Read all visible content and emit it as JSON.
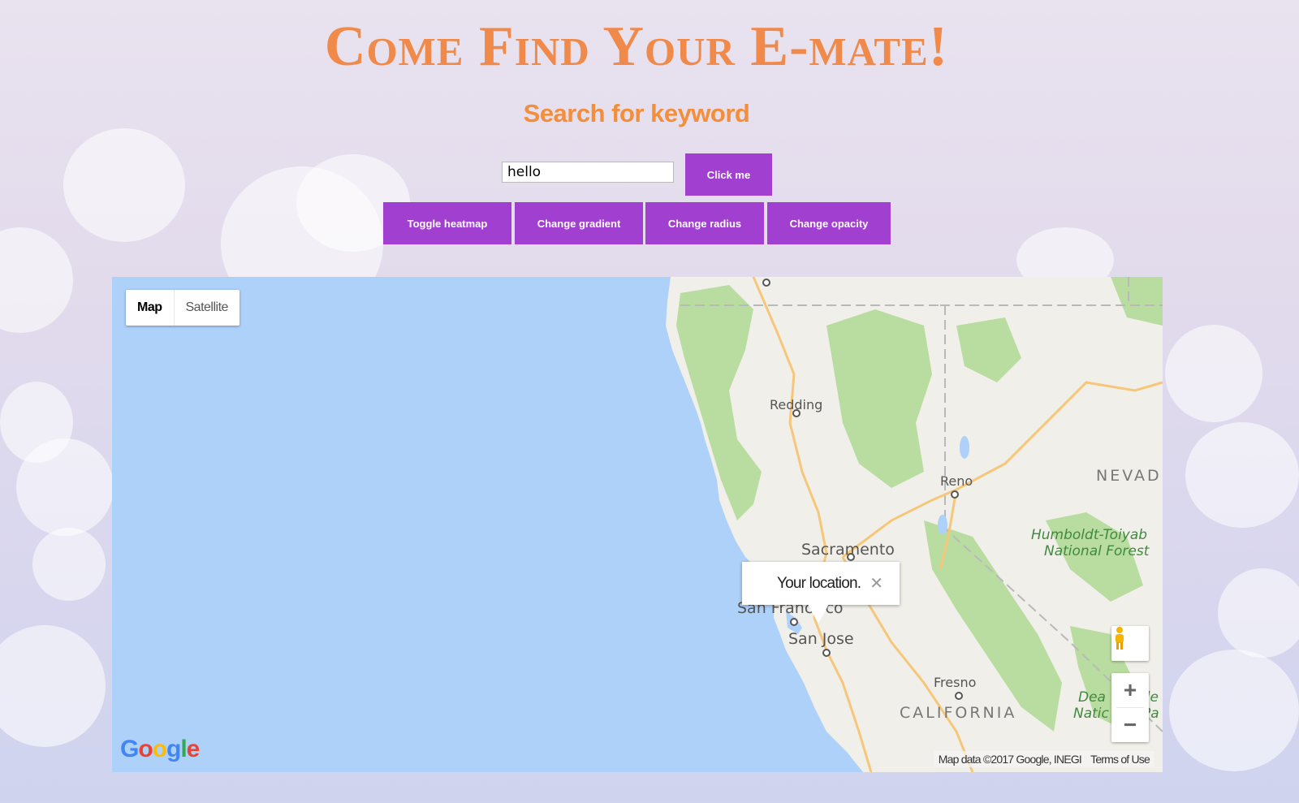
{
  "header": {
    "title": "Come Find Your E-mate!",
    "subtitle": "Search for keyword"
  },
  "search": {
    "value": "hello",
    "submit_label": "Click me"
  },
  "toolbar": {
    "toggle_heatmap": "Toggle heatmap",
    "change_gradient": "Change gradient",
    "change_radius": "Change radius",
    "change_opacity": "Change opacity"
  },
  "map": {
    "type_control": {
      "map_label": "Map",
      "satellite_label": "Satellite",
      "selected": "Map"
    },
    "info_window": {
      "text": "Your location.",
      "close_glyph": "✕"
    },
    "labels": {
      "redding": "Redding",
      "reno": "Reno",
      "nevada": "NEVAD",
      "sacramento": "Sacramento",
      "san_francisco": "San Francisco",
      "san_jose": "San Jose",
      "fresno": "Fresno",
      "california": "CALIFORNIA",
      "humboldt": "Humboldt-Toiyab",
      "national_forest": "National Forest",
      "death_valley_1": "Dea",
      "death_valley_2": "Natic",
      "death_valley_3": "lle",
      "death_valley_4": "Pa"
    },
    "zoom_in": "+",
    "zoom_out": "−",
    "logo": {
      "g1": "G",
      "o1": "o",
      "o2": "o",
      "g2": "g",
      "l": "l",
      "e": "e"
    },
    "attribution": "Map data ©2017 Google, INEGI",
    "terms": "Terms of Use",
    "colors": {
      "water": "#aed1fa",
      "land": "#f1efe9",
      "forest": "#b9dca0",
      "roads": "#f6c77a",
      "accent_button": "#a13fd1"
    }
  }
}
